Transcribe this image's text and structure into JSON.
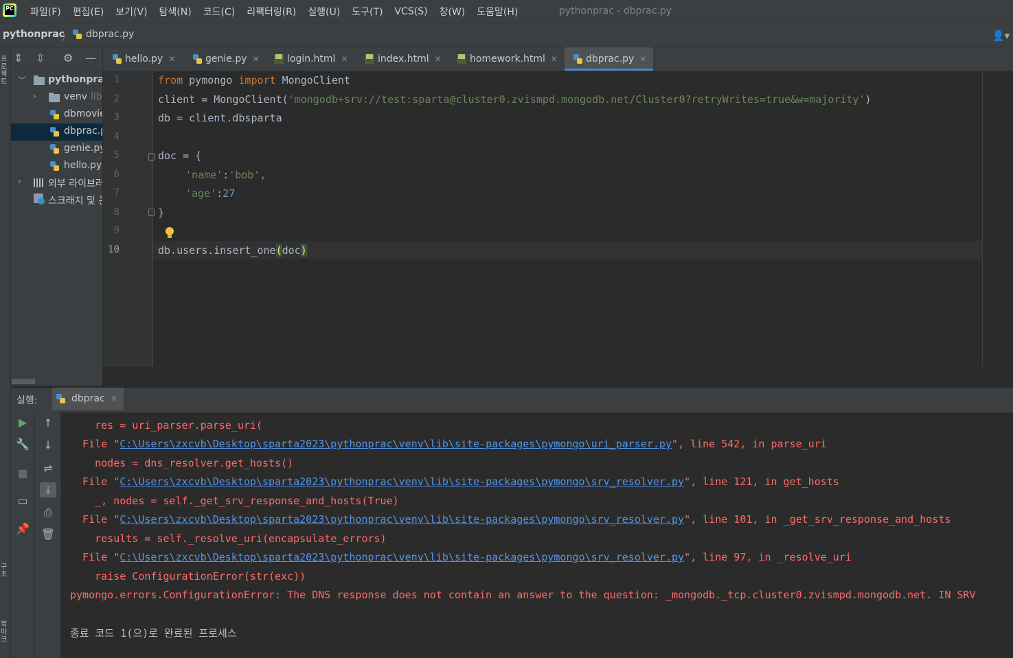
{
  "menu": {
    "logo_text": "PC",
    "items": [
      "파일(F)",
      "편집(E)",
      "보기(V)",
      "탐색(N)",
      "코드(C)",
      "리팩터링(R)",
      "실행(U)",
      "도구(T)",
      "VCS(S)",
      "창(W)",
      "도움말(H)"
    ],
    "window_title": "pythonprac - dbprac.py"
  },
  "navbar": {
    "project": "pythonprac",
    "separator": "〉",
    "file": "dbprac.py",
    "user_icon": "user-icon"
  },
  "left_stripe": {
    "project_label": "프로젝트",
    "structure_label": "구조",
    "bookmarks_label": "북마크"
  },
  "project_tree": {
    "items": [
      {
        "label": "pythonprac",
        "type": "folder",
        "expanded": true
      },
      {
        "label": "venv",
        "suffix": "library root",
        "type": "folder",
        "expanded": false
      },
      {
        "label": "dbmovie.py",
        "type": "python"
      },
      {
        "label": "dbprac.py",
        "type": "python",
        "selected": true
      },
      {
        "label": "genie.py",
        "type": "python"
      },
      {
        "label": "hello.py",
        "type": "python"
      },
      {
        "label": "외부 라이브러리",
        "type": "library",
        "expanded": false
      },
      {
        "label": "스크래치 및 콘솔",
        "type": "scratch"
      }
    ]
  },
  "tabs": [
    {
      "label": "hello.py",
      "type": "python"
    },
    {
      "label": "genie.py",
      "type": "python"
    },
    {
      "label": "login.html",
      "type": "html"
    },
    {
      "label": "index.html",
      "type": "html"
    },
    {
      "label": "homework.html",
      "type": "html"
    },
    {
      "label": "dbprac.py",
      "type": "python",
      "active": true
    }
  ],
  "editor": {
    "line_numbers": [
      "1",
      "2",
      "3",
      "4",
      "5",
      "6",
      "7",
      "8",
      "9",
      "10"
    ],
    "current_line": 10,
    "lines": {
      "l1_from": "from",
      "l1_mod": " pymongo ",
      "l1_import": "import",
      "l1_name": " MongoClient",
      "l2_pre": "client = MongoClient(",
      "l2_str": "'mongodb+srv://test:sparta@cluster0.zvismpd.mongodb.net/Cluster0?retryWrites=true&w=majority'",
      "l2_post": ")",
      "l3": "db = client.dbsparta",
      "l5": "doc = {",
      "l6_key": "'name'",
      "l6_colon": ":",
      "l6_val": "'bob'",
      "l6_comma": ",",
      "l7_key": "'age'",
      "l7_colon": ":",
      "l7_val": "27",
      "l8": "}",
      "l10_pre": "db.users.insert_one",
      "l10_open": "(",
      "l10_arg": "doc",
      "l10_close": ")"
    }
  },
  "run_panel": {
    "label": "실행:",
    "tab_name": "dbprac",
    "console": {
      "l1": "    res = uri_parser.parse_uri(",
      "l2_pre": "  File \"",
      "l2_link": "C:\\Users\\zxcvb\\Desktop\\sparta2023\\pythonprac\\venv\\lib\\site-packages\\pymongo\\uri_parser.py",
      "l2_post": "\", line 542, in parse_uri",
      "l3": "    nodes = dns_resolver.get_hosts()",
      "l4_pre": "  File \"",
      "l4_link": "C:\\Users\\zxcvb\\Desktop\\sparta2023\\pythonprac\\venv\\lib\\site-packages\\pymongo\\srv_resolver.py",
      "l4_post": "\", line 121, in get_hosts",
      "l5": "    _, nodes = self._get_srv_response_and_hosts(True)",
      "l6_pre": "  File \"",
      "l6_link": "C:\\Users\\zxcvb\\Desktop\\sparta2023\\pythonprac\\venv\\lib\\site-packages\\pymongo\\srv_resolver.py",
      "l6_post": "\", line 101, in _get_srv_response_and_hosts",
      "l7": "    results = self._resolve_uri(encapsulate_errors)",
      "l8_pre": "  File \"",
      "l8_link": "C:\\Users\\zxcvb\\Desktop\\sparta2023\\pythonprac\\venv\\lib\\site-packages\\pymongo\\srv_resolver.py",
      "l8_post": "\", line 97, in _resolve_uri",
      "l9": "    raise ConfigurationError(str(exc))",
      "l10": "pymongo.errors.ConfigurationError: The DNS response does not contain an answer to the question: _mongodb._tcp.cluster0.zvismpd.mongodb.net. IN SRV",
      "l11": "종료 코드 1(으)로 완료된 프로세스"
    }
  },
  "colors": {
    "accent": "#4a88c7",
    "error": "#ff6b68",
    "link": "#5394ec",
    "keyword": "#cc7832",
    "string": "#6a8759",
    "number": "#6897bb"
  }
}
